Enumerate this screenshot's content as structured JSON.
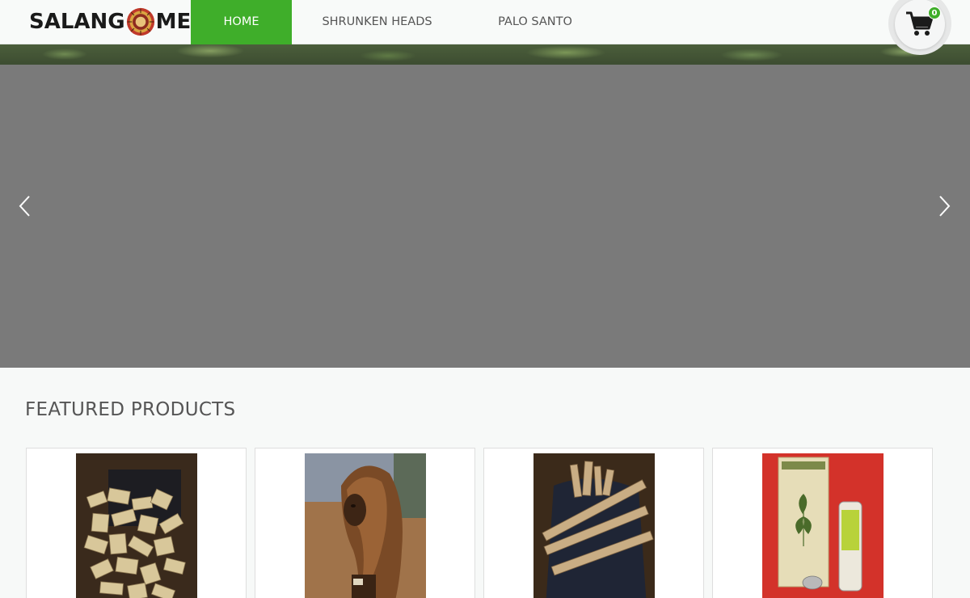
{
  "brand": {
    "logo_left": "SALANG",
    "logo_right": "ME"
  },
  "nav": [
    {
      "label": "HOME"
    },
    {
      "label": "SHRUNKEN HEADS"
    },
    {
      "label": "PALO SANTO"
    }
  ],
  "cart": {
    "count": "0",
    "icon": "shopping-cart-icon"
  },
  "slider": {
    "prev_icon": "chevron-left-icon",
    "next_icon": "chevron-right-icon"
  },
  "featured": {
    "title": "FEATURED PRODUCTS",
    "products": [
      {
        "image": "palo-santo-chips-photo"
      },
      {
        "image": "shrunken-head-photo"
      },
      {
        "image": "palo-santo-sticks-photo"
      },
      {
        "image": "palo-santo-oil-photo"
      }
    ]
  },
  "colors": {
    "accent": "#3fae2a",
    "slider_bg": "#7a7a7a",
    "page_bg": "#f7f9f8"
  }
}
